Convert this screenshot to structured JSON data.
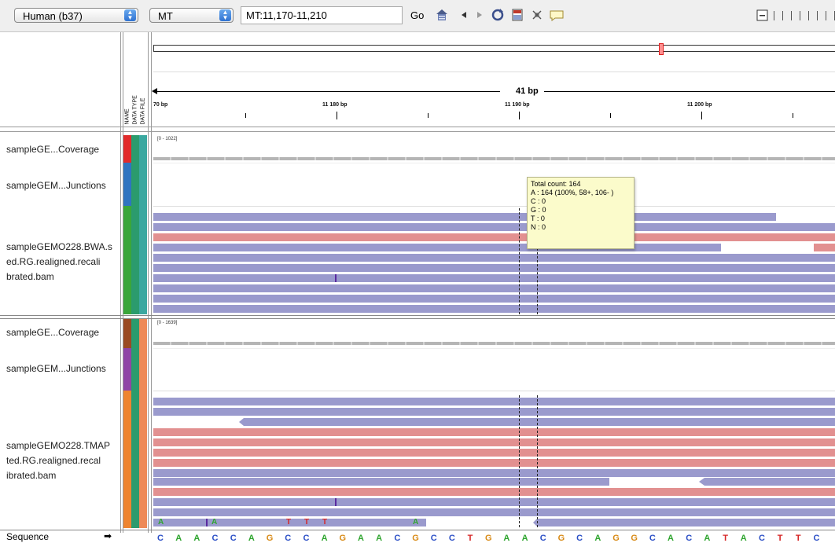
{
  "toolbar": {
    "genome": "Human (b37)",
    "chromosome": "MT",
    "locus": "MT:11,170-11,210",
    "go_label": "Go"
  },
  "ruler": {
    "span_label": "41 bp",
    "tick_labels": [
      "70 bp",
      "11 180 bp",
      "11 190 bp",
      "11 200 bp"
    ]
  },
  "attribute_headers": [
    "NAME",
    "DATA TYPE",
    "DATA FILE"
  ],
  "panel1": {
    "coverage_name": "sampleGE...Coverage",
    "junctions_name": "sampleGEM...Junctions",
    "bam_name_lines": [
      "sampleGEMO228.BWA.s",
      "ed.RG.realigned.recali",
      "brated.bam"
    ],
    "coverage_range": "[0 - 1022]"
  },
  "panel2": {
    "coverage_name": "sampleGE...Coverage",
    "junctions_name": "sampleGEM...Junctions",
    "bam_name_lines": [
      "sampleGEMO228.TMAP",
      "ted.RG.realigned.recal",
      "ibrated.bam"
    ],
    "coverage_range": "[0 - 1639]"
  },
  "tooltip": {
    "lines": [
      "Total count: 164",
      "A : 164 (100%, 58+, 106- )",
      "C : 0",
      "G : 0",
      "T : 0",
      "N : 0"
    ]
  },
  "sequence": {
    "label": "Sequence",
    "arrow": "➡",
    "bases": [
      "C",
      "A",
      "A",
      "C",
      "C",
      "A",
      "G",
      "C",
      "C",
      "A",
      "G",
      "A",
      "A",
      "C",
      "G",
      "C",
      "C",
      "T",
      "G",
      "A",
      "A",
      "C",
      "G",
      "C",
      "A",
      "G",
      "G",
      "C",
      "A",
      "C",
      "A",
      "T",
      "A",
      "C",
      "T",
      "T",
      "C"
    ]
  },
  "mismatches": [
    "A",
    "A",
    "T",
    "T",
    "T",
    "A"
  ],
  "colors": {
    "A": "#2fa52f",
    "C": "#2b4fc6",
    "G": "#d88a16",
    "T": "#d62424",
    "read_forward": "#9a9acd",
    "read_reverse": "#e29090"
  }
}
